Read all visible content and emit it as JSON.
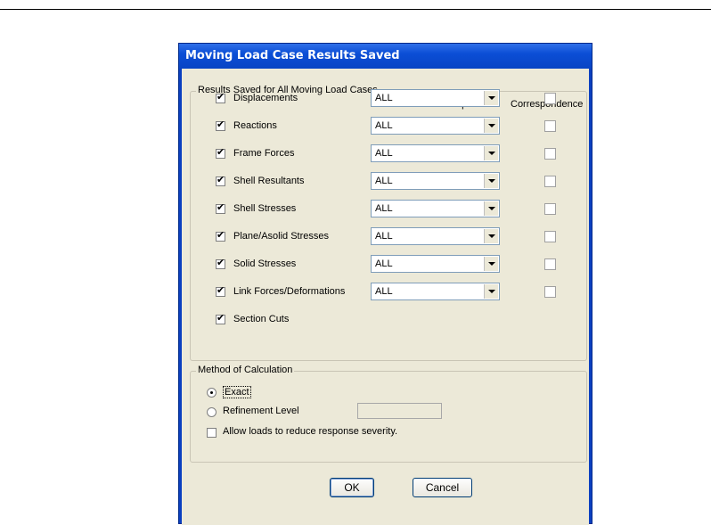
{
  "dialog": {
    "title": "Moving Load Case Results Saved"
  },
  "results_group": {
    "legend": "Results Saved for All Moving Load Cases",
    "col_select_group": "Select Group",
    "col_correspondence": "Correspondence",
    "rows": [
      {
        "label": "Displacements",
        "checked": true,
        "group": "ALL",
        "correspondence": false
      },
      {
        "label": "Reactions",
        "checked": true,
        "group": "ALL",
        "correspondence": false
      },
      {
        "label": "Frame Forces",
        "checked": true,
        "group": "ALL",
        "correspondence": false
      },
      {
        "label": "Shell Resultants",
        "checked": true,
        "group": "ALL",
        "correspondence": false
      },
      {
        "label": "Shell Stresses",
        "checked": true,
        "group": "ALL",
        "correspondence": false
      },
      {
        "label": "Plane/Asolid Stresses",
        "checked": true,
        "group": "ALL",
        "correspondence": false
      },
      {
        "label": "Solid Stresses",
        "checked": true,
        "group": "ALL",
        "correspondence": false
      },
      {
        "label": "Link Forces/Deformations",
        "checked": true,
        "group": "ALL",
        "correspondence": false
      },
      {
        "label": "Section Cuts",
        "checked": true
      }
    ]
  },
  "method_group": {
    "legend": "Method of Calculation",
    "exact_label": "Exact",
    "exact_selected": true,
    "refinement_label": "Refinement Level",
    "refinement_value": "",
    "allow_loads_label": "Allow loads to reduce response severity.",
    "allow_loads_checked": false
  },
  "buttons": {
    "ok_label": "OK",
    "cancel_label": "Cancel"
  }
}
